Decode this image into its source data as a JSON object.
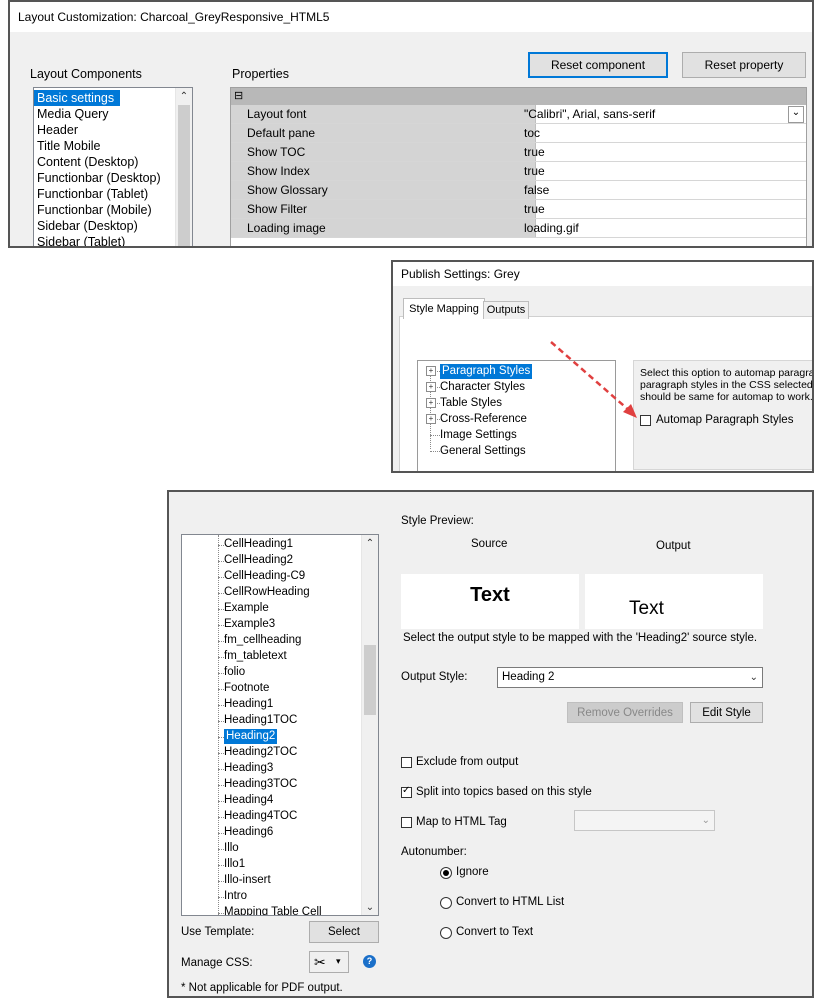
{
  "layout_dialog": {
    "title": "Layout Customization: Charcoal_GreyResponsive_HTML5",
    "components_label": "Layout Components",
    "properties_label": "Properties",
    "reset_component": "Reset component",
    "reset_property": "Reset property",
    "components": [
      "Basic settings",
      "Media Query",
      "Header",
      "Title Mobile",
      "Content (Desktop)",
      "Functionbar (Desktop)",
      "Functionbar (Tablet)",
      "Functionbar (Mobile)",
      "Sidebar (Desktop)",
      "Sidebar (Tablet)"
    ],
    "selected_component": 0,
    "collapse_glyph": "⊟",
    "properties": [
      {
        "name": "Layout font",
        "value": "\"Calibri\", Arial, sans-serif"
      },
      {
        "name": "Default pane",
        "value": "toc"
      },
      {
        "name": "Show TOC",
        "value": "true"
      },
      {
        "name": "Show Index",
        "value": "true"
      },
      {
        "name": "Show Glossary",
        "value": "false"
      },
      {
        "name": "Show Filter",
        "value": "true"
      },
      {
        "name": "Loading image",
        "value": "loading.gif"
      }
    ]
  },
  "publish_dialog": {
    "title": "Publish Settings: Grey",
    "tabs": [
      "Style Mapping",
      "Outputs"
    ],
    "active_tab": 0,
    "tree": [
      {
        "label": "Paragraph Styles",
        "expandable": true,
        "selected": true
      },
      {
        "label": "Character Styles",
        "expandable": true,
        "selected": false
      },
      {
        "label": "Table Styles",
        "expandable": true,
        "selected": false
      },
      {
        "label": "Cross-Reference",
        "expandable": true,
        "selected": false
      },
      {
        "label": "Image Settings",
        "expandable": false,
        "selected": false
      },
      {
        "label": "General Settings",
        "expandable": false,
        "selected": false
      }
    ],
    "info_lines": [
      "Select this option to automap paragra",
      "paragraph styles in the CSS selected",
      "should be same for automap to work."
    ],
    "automap_label": "Automap Paragraph Styles",
    "automap_checked": false,
    "arrow_color": "#e04040"
  },
  "style_dialog": {
    "styles": [
      "CellHeading1",
      "CellHeading2",
      "CellHeading-C9",
      "CellRowHeading",
      "Example",
      "Example3",
      "fm_cellheading",
      "fm_tabletext",
      "folio",
      "Footnote",
      "Heading1",
      "Heading1TOC",
      "Heading2",
      "Heading2TOC",
      "Heading3",
      "Heading3TOC",
      "Heading4",
      "Heading4TOC",
      "Heading6",
      "Illo",
      "Illo1",
      "Illo-insert",
      "Intro",
      "Mapping Table Cell"
    ],
    "selected_style": 12,
    "style_preview_label": "Style Preview:",
    "source_label": "Source",
    "output_label": "Output",
    "preview_source_text": "Text",
    "preview_output_text": "Text",
    "mapping_hint": "Select the output style to be mapped with the 'Heading2' source style.",
    "output_style_label": "Output Style:",
    "output_style_value": "Heading 2",
    "remove_overrides": "Remove Overrides",
    "edit_style": "Edit Style",
    "exclude_label": "Exclude from output",
    "exclude_checked": false,
    "split_label": "Split into topics based on this style",
    "split_checked": true,
    "map_html_label": "Map to HTML Tag",
    "map_html_checked": false,
    "autonumber_label": "Autonumber:",
    "autonumber_options": [
      "Ignore",
      "Convert to HTML List",
      "Convert to Text"
    ],
    "autonumber_selected": 0,
    "use_template_label": "Use Template:",
    "select_button": "Select",
    "manage_css_label": "Manage CSS:",
    "footnote": "* Not applicable for PDF output.",
    "help_icon_color": "#1a6fc9"
  }
}
